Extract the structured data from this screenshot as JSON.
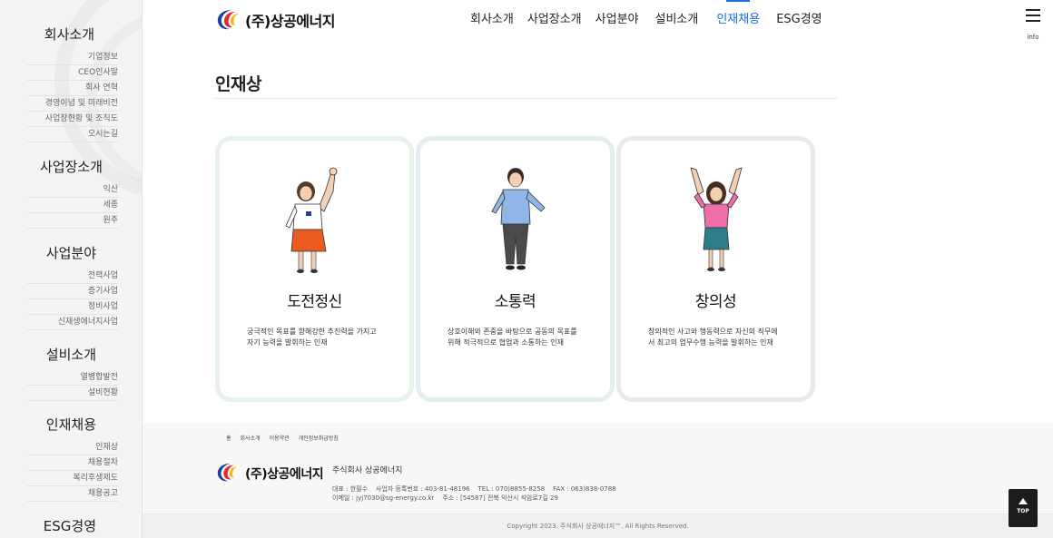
{
  "sidebar": {
    "groups": [
      {
        "title": "회사소개",
        "items": [
          "기업정보",
          "CEO인사말",
          "회사 연혁",
          "경영이념 및 미래비전",
          "사업장현황 및 조직도",
          "오시는길"
        ]
      },
      {
        "title": "사업장소개",
        "items": [
          "익산",
          "세종",
          "원주"
        ]
      },
      {
        "title": "사업분야",
        "items": [
          "전력사업",
          "증기사업",
          "정비사업",
          "신재생에너지사업"
        ]
      },
      {
        "title": "설비소개",
        "items": [
          "열병합발전",
          "설비현황"
        ]
      },
      {
        "title": "인재채용",
        "items": [
          "인재상",
          "채용절차",
          "복리후생제도",
          "채용공고"
        ]
      },
      {
        "title": "ESG경영",
        "items": []
      }
    ]
  },
  "header": {
    "logo_text": "(주)상공에너지",
    "nav": [
      "회사소개",
      "사업장소개",
      "사업분야",
      "설비소개",
      "인재채용",
      "ESG경영"
    ],
    "active_nav": "인재채용",
    "menu_label": "info"
  },
  "main": {
    "title": "인재상",
    "cards": [
      {
        "title": "도전정신",
        "desc1": "궁극적인 목표를 향해강한 추진력을 가지고",
        "desc2": "자기 능력을 발휘하는 인재"
      },
      {
        "title": "소통력",
        "desc1": "상호이해와 존중을 바탕으로 공동의 목표를",
        "desc2": "위해 적극적으로 협업과 소통하는 인재"
      },
      {
        "title": "창의성",
        "desc1": "창의적인 사고와 행동력으로 자신의 직무에",
        "desc2": "서 최고의 업무수행 능력을 발휘하는 인재"
      }
    ]
  },
  "footer": {
    "links": [
      "홈",
      "회사소개",
      "이용약관",
      "개인정보취급방침"
    ],
    "logo_text": "(주)상공에너지",
    "company": "주식회사 상공에너지",
    "info_line1": "대표 : 한필수    사업자 등록번호 : 403-81-48196    TEL : 070)8855-8258    FAX : 063)838-0788",
    "info_line2": "이메일 : jyj7030@sg-energy.co.kr    주소 : [54587] 전북 익산시 석암로7길 29",
    "copyright": "Copyright 2023. 주식회사 상공에너지™. All Rights Reserved.",
    "top_label": "TOP"
  },
  "colors": {
    "accent": "#1a6fdc",
    "logo_red": "#e8262d",
    "logo_blue": "#1e3f9c",
    "logo_yellow": "#f4b400"
  }
}
